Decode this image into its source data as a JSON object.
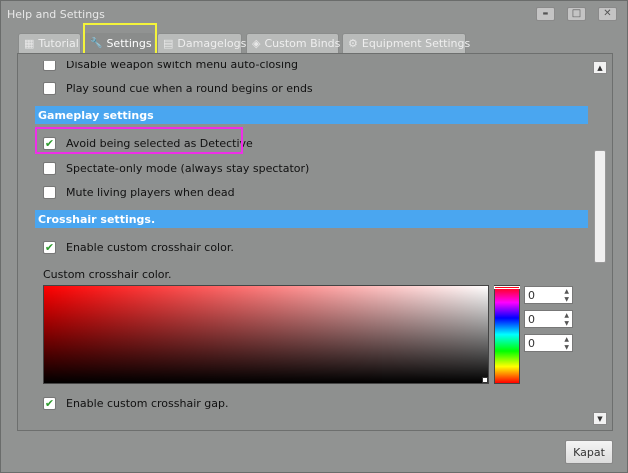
{
  "window": {
    "title": "Help and Settings",
    "controls": {
      "minimize": "▬",
      "maximize": "□",
      "close": "✕"
    }
  },
  "tabs": [
    {
      "label": "Tutorial",
      "icon": "book-icon",
      "glyph": "▦"
    },
    {
      "label": "Settings",
      "icon": "wrench-icon",
      "glyph": "🔧",
      "active": true
    },
    {
      "label": "Damagelogs",
      "icon": "table-icon",
      "glyph": "▤"
    },
    {
      "label": "Custom Binds",
      "icon": "cube-icon",
      "glyph": "◈"
    },
    {
      "label": "Equipment Settings",
      "icon": "gear-icon",
      "glyph": "⚙"
    }
  ],
  "settings": {
    "weapon_switch": {
      "label": "Disable weapon switch menu auto-closing",
      "checked": false
    },
    "round_cue": {
      "label": "Play sound cue when a round begins or ends",
      "checked": false
    },
    "gameplay_header": "Gameplay settings",
    "avoid_detective": {
      "label": "Avoid being selected as Detective",
      "checked": true
    },
    "spectate_only": {
      "label": "Spectate-only mode (always stay spectator)",
      "checked": false
    },
    "mute_living": {
      "label": "Mute living players when dead",
      "checked": false
    },
    "crosshair_header": "Crosshair settings.",
    "custom_color": {
      "label": "Enable custom crosshair color.",
      "checked": true
    },
    "custom_color_label": "Custom crosshair color.",
    "color_values": {
      "r": "0",
      "g": "0",
      "b": "0"
    },
    "custom_gap": {
      "label": "Enable custom crosshair gap.",
      "checked": true
    }
  },
  "scrollbar": {
    "up": "▲",
    "down": "▼"
  },
  "footer": {
    "close_label": "Kapat"
  },
  "colors": {
    "section_header": "#4aa6f0",
    "highlight_settings_tab": "#f4f43a",
    "highlight_detective": "#ee2ee8",
    "check": "#2f9b2f"
  },
  "check_glyph": "✔"
}
